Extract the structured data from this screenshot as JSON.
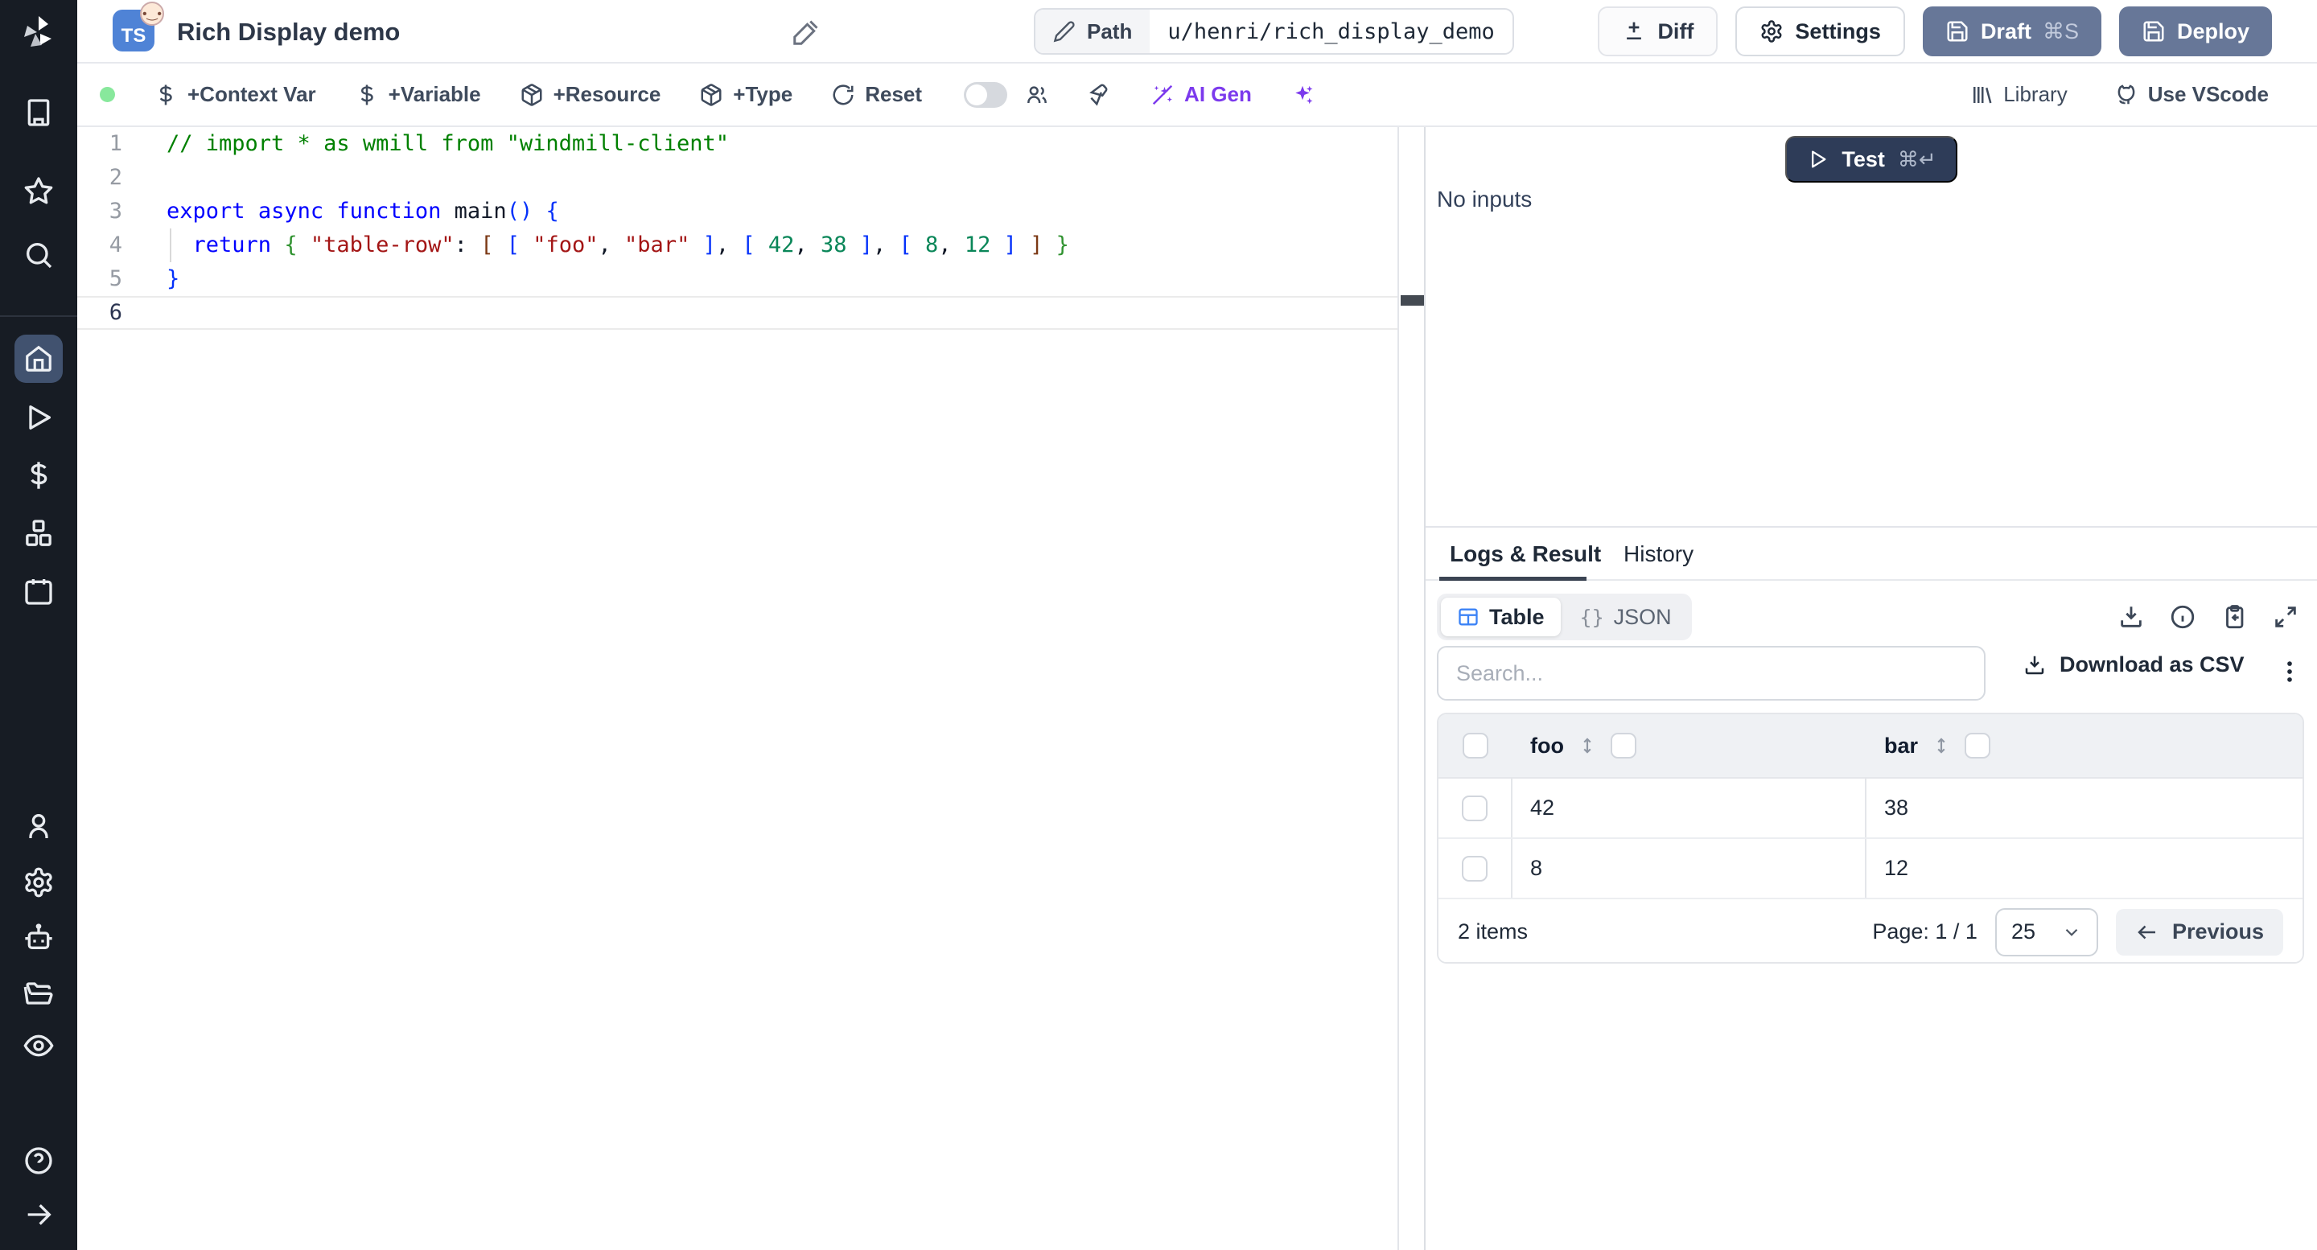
{
  "app": {
    "name": "Windmill",
    "lang_badge": "TS"
  },
  "header": {
    "title": "Rich Display demo",
    "path_label": "Path",
    "path_value": "u/henri/rich_display_demo",
    "diff_label": "Diff",
    "settings_label": "Settings",
    "draft_label": "Draft",
    "draft_kbd": "⌘S",
    "deploy_label": "Deploy"
  },
  "toolbar": {
    "context_var": "+Context Var",
    "variable": "+Variable",
    "resource": "+Resource",
    "type": "+Type",
    "reset": "Reset",
    "ai_gen": "AI Gen",
    "library": "Library",
    "vscode": "Use VScode"
  },
  "editor": {
    "line_numbers": [
      "1",
      "2",
      "3",
      "4",
      "5",
      "6"
    ],
    "active_line": "6",
    "lines": [
      {
        "tokens": [
          {
            "c": "comment",
            "t": "// import * as wmill from \"windmill-client\""
          }
        ]
      },
      {
        "tokens": []
      },
      {
        "tokens": [
          {
            "c": "kw",
            "t": "export"
          },
          {
            "c": "pl",
            "t": " "
          },
          {
            "c": "kw",
            "t": "async"
          },
          {
            "c": "pl",
            "t": " "
          },
          {
            "c": "kw",
            "t": "function"
          },
          {
            "c": "pl",
            "t": " main"
          },
          {
            "c": "b1",
            "t": "()"
          },
          {
            "c": "pl",
            "t": " "
          },
          {
            "c": "b1",
            "t": "{"
          }
        ]
      },
      {
        "tokens": [
          {
            "c": "pl",
            "t": "  "
          },
          {
            "c": "kw",
            "t": "return"
          },
          {
            "c": "pl",
            "t": " "
          },
          {
            "c": "b2",
            "t": "{"
          },
          {
            "c": "pl",
            "t": " "
          },
          {
            "c": "str",
            "t": "\"table-row\""
          },
          {
            "c": "pl",
            "t": ": "
          },
          {
            "c": "b3",
            "t": "["
          },
          {
            "c": "pl",
            "t": " "
          },
          {
            "c": "b1",
            "t": "["
          },
          {
            "c": "pl",
            "t": " "
          },
          {
            "c": "str",
            "t": "\"foo\""
          },
          {
            "c": "pl",
            "t": ", "
          },
          {
            "c": "str",
            "t": "\"bar\""
          },
          {
            "c": "pl",
            "t": " "
          },
          {
            "c": "b1",
            "t": "]"
          },
          {
            "c": "pl",
            "t": ", "
          },
          {
            "c": "b1",
            "t": "["
          },
          {
            "c": "pl",
            "t": " "
          },
          {
            "c": "num",
            "t": "42"
          },
          {
            "c": "pl",
            "t": ", "
          },
          {
            "c": "num",
            "t": "38"
          },
          {
            "c": "pl",
            "t": " "
          },
          {
            "c": "b1",
            "t": "]"
          },
          {
            "c": "pl",
            "t": ", "
          },
          {
            "c": "b1",
            "t": "["
          },
          {
            "c": "pl",
            "t": " "
          },
          {
            "c": "num",
            "t": "8"
          },
          {
            "c": "pl",
            "t": ", "
          },
          {
            "c": "num",
            "t": "12"
          },
          {
            "c": "pl",
            "t": " "
          },
          {
            "c": "b1",
            "t": "]"
          },
          {
            "c": "pl",
            "t": " "
          },
          {
            "c": "b3",
            "t": "]"
          },
          {
            "c": "pl",
            "t": " "
          },
          {
            "c": "b2",
            "t": "}"
          }
        ]
      },
      {
        "tokens": [
          {
            "c": "b1",
            "t": "}"
          }
        ]
      },
      {
        "tokens": []
      }
    ]
  },
  "run": {
    "test_label": "Test",
    "test_kbd": "⌘↵",
    "no_inputs": "No inputs"
  },
  "tabs": {
    "logs_result": "Logs & Result",
    "history": "History"
  },
  "result": {
    "table_toggle": "Table",
    "json_toggle": "JSON",
    "json_glyph": "{}",
    "search_placeholder": "Search...",
    "download_csv": "Download as CSV"
  },
  "result_table": {
    "columns": [
      "foo",
      "bar"
    ],
    "rows": [
      {
        "foo": "42",
        "bar": "38"
      },
      {
        "foo": "8",
        "bar": "12"
      }
    ],
    "items_label": "2 items",
    "page_label": "Page: 1 / 1",
    "page_size": "25",
    "previous_label": "Previous"
  },
  "sidebar": {
    "icons": [
      "windmill-logo",
      "building",
      "star",
      "search",
      "home",
      "play",
      "dollar",
      "boxes",
      "calendar",
      "user",
      "settings",
      "bot",
      "folder",
      "eye",
      "help",
      "collapse-arrow"
    ],
    "active_item": "home"
  },
  "colors": {
    "sidebar_bg": "#171c24",
    "active_nav_bg": "#41526f",
    "primary_button": "#677798",
    "test_button": "#2e3c58",
    "ai_accent": "#7c3aed",
    "status_dot": "#88e89c",
    "table_icon_blue": "#3b82f6",
    "code_keyword": "#0000ff",
    "code_string": "#a31515",
    "code_number": "#098658",
    "code_comment": "#008000"
  }
}
